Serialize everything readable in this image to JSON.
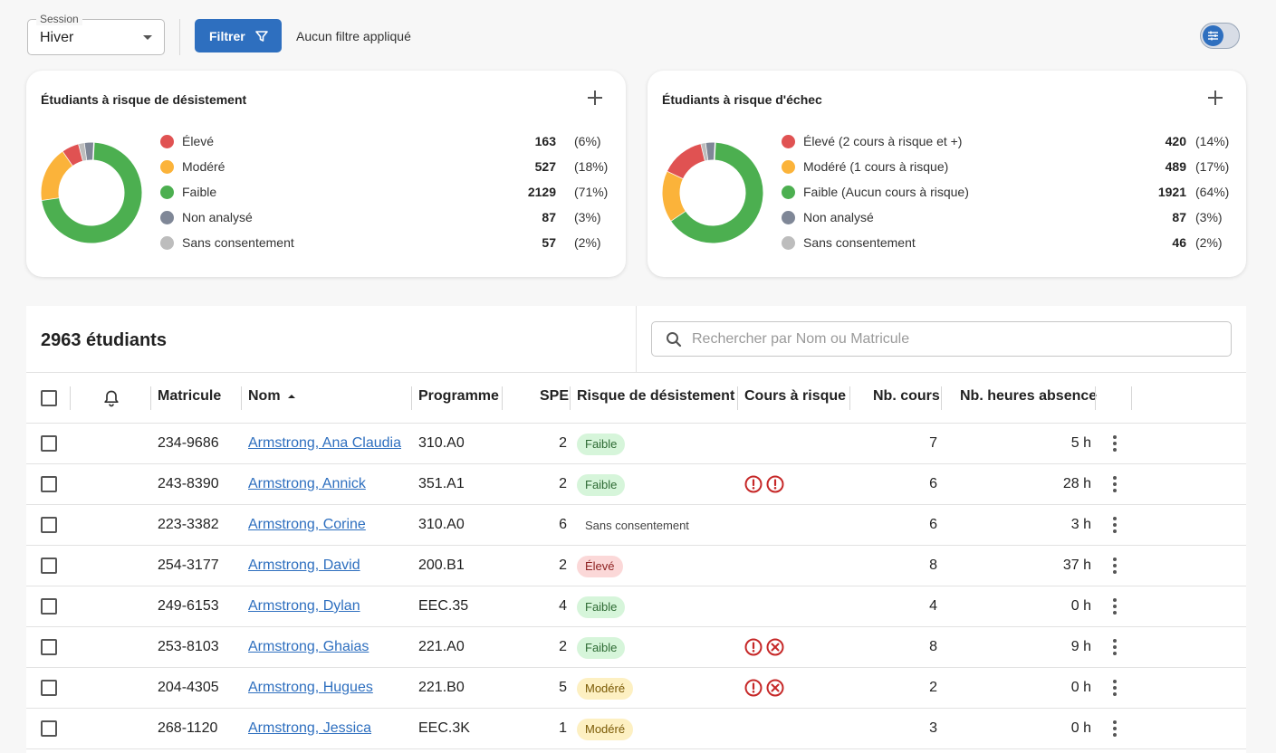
{
  "toolbar": {
    "session_label": "Session",
    "session_value": "Hiver",
    "filter_button": "Filtrer",
    "filter_status": "Aucun filtre appliqué"
  },
  "colors": {
    "eleve": "#e05252",
    "modere": "#fbb33a",
    "faible": "#4caf50",
    "non_analyse": "#7f8797",
    "sans_consentement": "#bdbdbd",
    "accent": "#2e6fbf"
  },
  "card_desistement": {
    "title": "Étudiants à risque de désistement",
    "items": [
      {
        "label": "Élevé",
        "count": "163",
        "pct": "(6%)",
        "value": 163
      },
      {
        "label": "Modéré",
        "count": "527",
        "pct": "(18%)",
        "value": 527
      },
      {
        "label": "Faible",
        "count": "2129",
        "pct": "(71%)",
        "value": 2129
      },
      {
        "label": "Non analysé",
        "count": "87",
        "pct": "(3%)",
        "value": 87
      },
      {
        "label": "Sans consentement",
        "count": "57",
        "pct": "(2%)",
        "value": 57
      }
    ]
  },
  "card_echec": {
    "title": "Étudiants à risque d'échec",
    "items": [
      {
        "label": "Élevé (2 cours à risque et +)",
        "count": "420",
        "pct": "(14%)",
        "value": 420
      },
      {
        "label": "Modéré (1 cours à risque)",
        "count": "489",
        "pct": "(17%)",
        "value": 489
      },
      {
        "label": "Faible (Aucun cours à risque)",
        "count": "1921",
        "pct": "(64%)",
        "value": 1921
      },
      {
        "label": "Non analysé",
        "count": "87",
        "pct": "(3%)",
        "value": 87
      },
      {
        "label": "Sans consentement",
        "count": "46",
        "pct": "(2%)",
        "value": 46
      }
    ]
  },
  "table": {
    "count_label": "2963 étudiants",
    "search_placeholder": "Rechercher par Nom ou Matricule",
    "columns": {
      "matricule": "Matricule",
      "nom": "Nom",
      "programme": "Programme",
      "spe": "SPE",
      "risque": "Risque de désistement",
      "cours": "Cours à risque",
      "nb_cours": "Nb. cours",
      "nb_heures": "Nb. heures absence"
    },
    "rows": [
      {
        "matricule": "234-9686",
        "nom": "Armstrong, Ana Claudia",
        "programme": "310.A0",
        "spe": "2",
        "risque": "Faible",
        "cours_icons": [],
        "nb_cours": "7",
        "nb_heures": "5 h"
      },
      {
        "matricule": "243-8390",
        "nom": "Armstrong, Annick",
        "programme": "351.A1",
        "spe": "2",
        "risque": "Faible",
        "cours_icons": [
          "alert",
          "alert"
        ],
        "nb_cours": "6",
        "nb_heures": "28 h"
      },
      {
        "matricule": "223-3382",
        "nom": "Armstrong, Corine",
        "programme": "310.A0",
        "spe": "6",
        "risque": "Sans consentement",
        "cours_icons": [],
        "nb_cours": "6",
        "nb_heures": "3 h"
      },
      {
        "matricule": "254-3177",
        "nom": "Armstrong, David",
        "programme": "200.B1",
        "spe": "2",
        "risque": "Élevé",
        "cours_icons": [],
        "nb_cours": "8",
        "nb_heures": "37 h"
      },
      {
        "matricule": "249-6153",
        "nom": "Armstrong, Dylan",
        "programme": "EEC.35",
        "spe": "4",
        "risque": "Faible",
        "cours_icons": [],
        "nb_cours": "4",
        "nb_heures": "0 h"
      },
      {
        "matricule": "253-8103",
        "nom": "Armstrong, Ghaias",
        "programme": "221.A0",
        "spe": "2",
        "risque": "Faible",
        "cours_icons": [
          "alert",
          "fail"
        ],
        "nb_cours": "8",
        "nb_heures": "9 h"
      },
      {
        "matricule": "204-4305",
        "nom": "Armstrong, Hugues",
        "programme": "221.B0",
        "spe": "5",
        "risque": "Modéré",
        "cours_icons": [
          "alert",
          "fail"
        ],
        "nb_cours": "2",
        "nb_heures": "0 h"
      },
      {
        "matricule": "268-1120",
        "nom": "Armstrong, Jessica",
        "programme": "EEC.3K",
        "spe": "1",
        "risque": "Modéré",
        "cours_icons": [],
        "nb_cours": "3",
        "nb_heures": "0 h"
      }
    ]
  }
}
